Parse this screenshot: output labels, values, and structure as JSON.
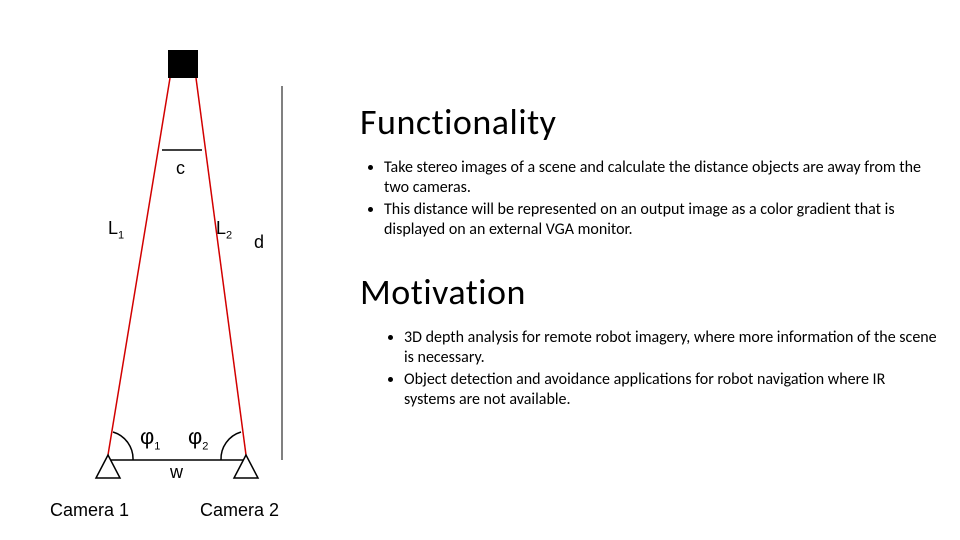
{
  "diagram": {
    "labels": {
      "c": "c",
      "L1": "L",
      "L1_sub": "1",
      "L2": "L",
      "L2_sub": "2",
      "d": "d",
      "phi1": "φ",
      "phi1_sub": "1",
      "phi2": "φ",
      "phi2_sub": "2",
      "w": "w",
      "camera1": "Camera 1",
      "camera2": "Camera 2"
    }
  },
  "sections": {
    "functionality": {
      "title": "Functionality",
      "bullets": [
        "Take stereo images of a scene and calculate the distance objects are away from the two cameras.",
        "This distance will be represented on an output image as a color gradient that is displayed on an external VGA monitor."
      ]
    },
    "motivation": {
      "title": "Motivation",
      "bullets": [
        "3D depth analysis for remote robot imagery, where more information of the scene is necessary.",
        "Object detection and avoidance applications for robot navigation where IR systems are not available."
      ]
    }
  }
}
